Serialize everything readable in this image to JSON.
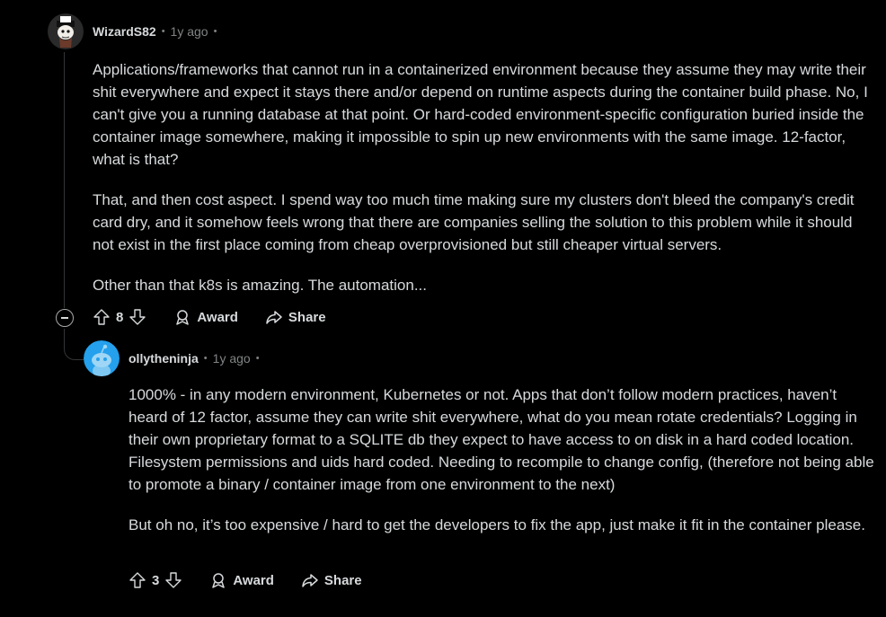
{
  "comments": [
    {
      "username": "WizardS82",
      "separator": "•",
      "time": "1y ago",
      "trail": "•",
      "paragraphs": [
        "Applications/frameworks that cannot run in a containerized environment because they assume they may write their shit everywhere and expect it stays there and/or depend on runtime aspects during the container build phase. No, I can't give you a running database at that point. Or hard-coded environment-specific configuration buried inside the container image somewhere, making it impossible to spin up new environments with the same image. 12-factor, what is that?",
        "That, and then cost aspect. I spend way too much time making sure my clusters don't bleed the company's credit card dry, and it somehow feels wrong that there are companies selling the solution to this problem while it should not exist in the first place coming from cheap overprovisioned but still cheaper virtual servers.",
        "Other than that k8s is amazing. The automation..."
      ],
      "score": "8",
      "award_label": "Award",
      "share_label": "Share"
    },
    {
      "username": "ollytheninja",
      "separator": "•",
      "time": "1y ago",
      "trail": "•",
      "paragraphs": [
        "1000% - in any modern environment, Kubernetes or not. Apps that don’t follow modern practices, haven’t heard of 12 factor, assume they can write shit everywhere, what do you mean rotate credentials? Logging in their own proprietary format to a SQLITE db they expect to have access to on disk in a hard coded location. Filesystem permissions and uids hard coded. Needing to recompile to change config, (therefore not being able to promote a binary / container image from one environment to the next)",
        "But oh no, it’s too expensive / hard to get the developers to fix the app, just make it fit in the container please."
      ],
      "score": "3",
      "award_label": "Award",
      "share_label": "Share"
    }
  ],
  "colors": {
    "background": "#000000",
    "text": "#d7dadc",
    "muted": "#818384",
    "line": "#343536",
    "snoo_bg": "#24a0ed"
  },
  "icons": [
    "upvote-icon",
    "downvote-icon",
    "award-icon",
    "share-icon",
    "collapse-icon"
  ]
}
